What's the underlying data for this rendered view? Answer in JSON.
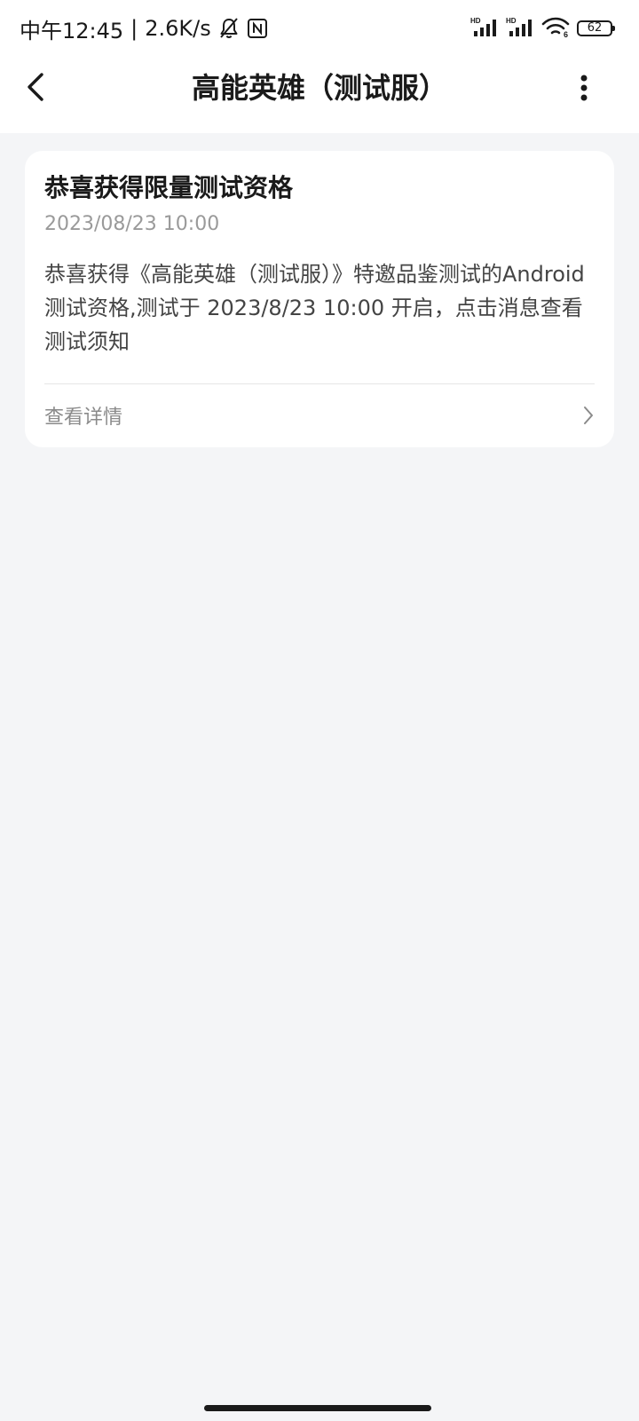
{
  "status_bar": {
    "time": "中午12:45",
    "separator": "|",
    "network_speed": "2.6K/s",
    "battery_level": "62",
    "signal_label_1": "HD",
    "signal_label_2": "HD",
    "wifi_label": "6",
    "icons": [
      "bell-off-icon",
      "nfc-icon",
      "signal-icon",
      "signal-icon",
      "wifi-icon",
      "battery-icon"
    ]
  },
  "header": {
    "title": "高能英雄（测试服）",
    "back_icon": "chevron-left-icon",
    "more_icon": "more-vertical-icon"
  },
  "message": {
    "title": "恭喜获得限量测试资格",
    "time": "2023/08/23 10:00",
    "body": "恭喜获得《高能英雄（测试服）》特邀品鉴测试的Android测试资格,测试于 2023/8/23 10:00 开启，点击消息查看测试须知",
    "action_label": "查看详情",
    "action_icon": "chevron-right-icon"
  },
  "colors": {
    "background": "#f4f5f7",
    "card": "#ffffff",
    "secondary_text": "#9a9a9a"
  }
}
